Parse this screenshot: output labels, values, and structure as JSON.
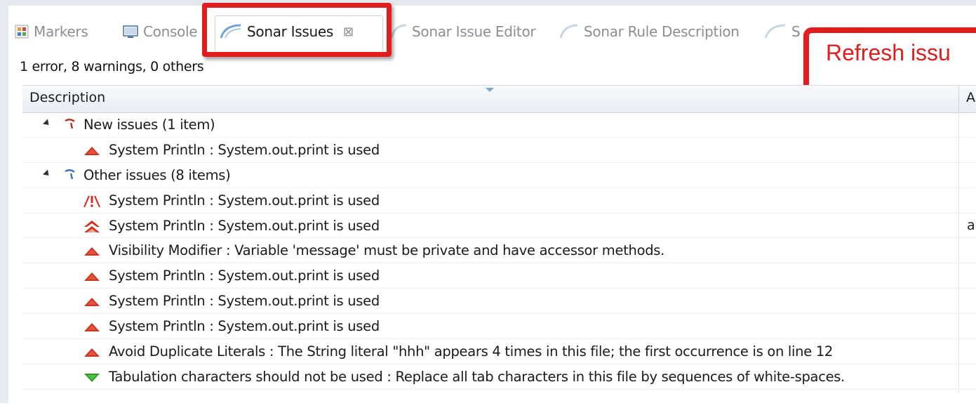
{
  "tabs": [
    {
      "label": "Markers",
      "icon": "markers-icon"
    },
    {
      "label": "Console",
      "icon": "console-icon"
    },
    {
      "label": "Sonar Issues",
      "icon": "sonar-icon",
      "active": true
    },
    {
      "label": "Sonar Issue Editor",
      "icon": "sonar-icon"
    },
    {
      "label": "Sonar Rule Description",
      "icon": "sonar-icon"
    },
    {
      "label": "S",
      "icon": "sonar-icon"
    }
  ],
  "callout": {
    "text": "Refresh issu"
  },
  "summary": "1 error, 8 warnings, 0 others",
  "table": {
    "columns": [
      "Description",
      "A"
    ],
    "groups": [
      {
        "label": "New issues (1 item)",
        "icon": "new-issues-icon",
        "items": [
          {
            "text": "System Println : System.out.print is used",
            "severity": "major",
            "extra": ""
          }
        ]
      },
      {
        "label": "Other issues (8 items)",
        "icon": "other-issues-icon",
        "items": [
          {
            "text": "System Println : System.out.print is used",
            "severity": "blocker",
            "extra": ""
          },
          {
            "text": "System Println : System.out.print is used",
            "severity": "critical",
            "extra": "a"
          },
          {
            "text": "Visibility Modifier : Variable 'message' must be private and have accessor methods.",
            "severity": "major",
            "extra": ""
          },
          {
            "text": "System Println : System.out.print is used",
            "severity": "major",
            "extra": ""
          },
          {
            "text": "System Println : System.out.print is used",
            "severity": "major",
            "extra": ""
          },
          {
            "text": "System Println : System.out.print is used",
            "severity": "major",
            "extra": ""
          },
          {
            "text": "Avoid Duplicate Literals : The String literal \"hhh\" appears 4 times in this file; the first occurrence is on line 12",
            "severity": "major",
            "extra": ""
          },
          {
            "text": "Tabulation characters should not be used : Replace all tab characters in this file by sequences of white-spaces.",
            "severity": "minor",
            "extra": ""
          }
        ]
      }
    ]
  },
  "colors": {
    "highlight": "#e21d1d",
    "major": "#c9341f",
    "minor": "#2e9a2a",
    "blocker": "#d8281c",
    "groupNew": "#b0342a",
    "groupOther": "#3d6fb5"
  }
}
